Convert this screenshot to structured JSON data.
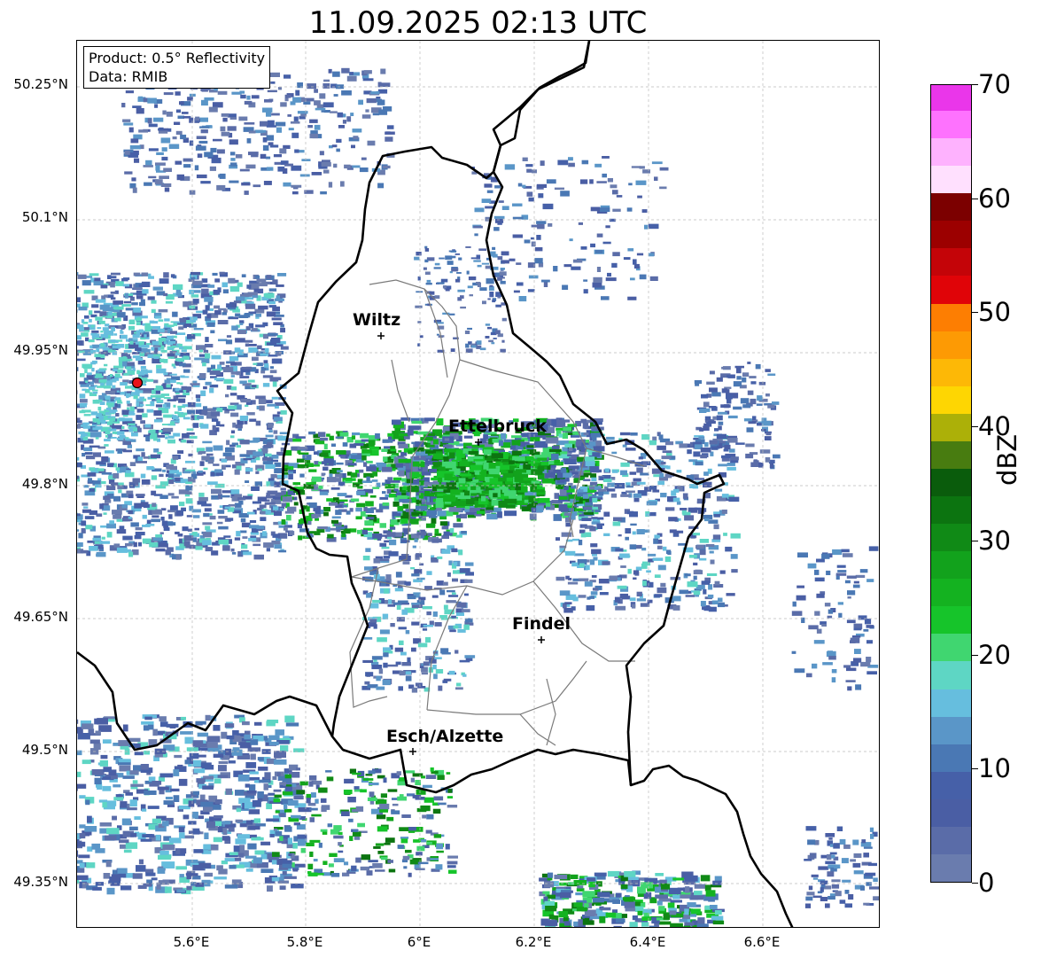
{
  "title": "11.09.2025 02:13 UTC",
  "info": {
    "product": "Product: 0.5° Reflectivity",
    "data": "Data: RMIB"
  },
  "lat_labels": [
    "50.25°N",
    "50.1°N",
    "49.95°N",
    "49.8°N",
    "49.65°N",
    "49.5°N",
    "49.35°N"
  ],
  "lon_labels": [
    "5.6°E",
    "5.8°E",
    "6°E",
    "6.2°E",
    "6.4°E",
    "6.6°E"
  ],
  "cities": [
    {
      "name": "Wiltz"
    },
    {
      "name": "Ettelbruck"
    },
    {
      "name": "Findel"
    },
    {
      "name": "Esch/Alzette"
    }
  ],
  "radar_site_color": "#e8111a",
  "colorbar": {
    "label": "dBZ",
    "ticks": [
      "0",
      "10",
      "20",
      "30",
      "40",
      "50",
      "60",
      "70"
    ],
    "min": 0,
    "max": 70,
    "step": 2.5,
    "colors": [
      "#6a7cae",
      "#5a6ca8",
      "#4a5ea4",
      "#4660a8",
      "#4a78b4",
      "#5a96c8",
      "#66bede",
      "#5ed6c4",
      "#40d670",
      "#16c42a",
      "#14b220",
      "#12a21c",
      "#108a16",
      "#0c7410",
      "#0a5c0c",
      "#487c10",
      "#acb008",
      "#fed602",
      "#fdb806",
      "#fd9a04",
      "#fd7e02",
      "#e00408",
      "#c40408",
      "#9c0000",
      "#7c0000",
      "#ffe0fe",
      "#feb2fe",
      "#fe72fe",
      "#ea36ea"
    ]
  }
}
